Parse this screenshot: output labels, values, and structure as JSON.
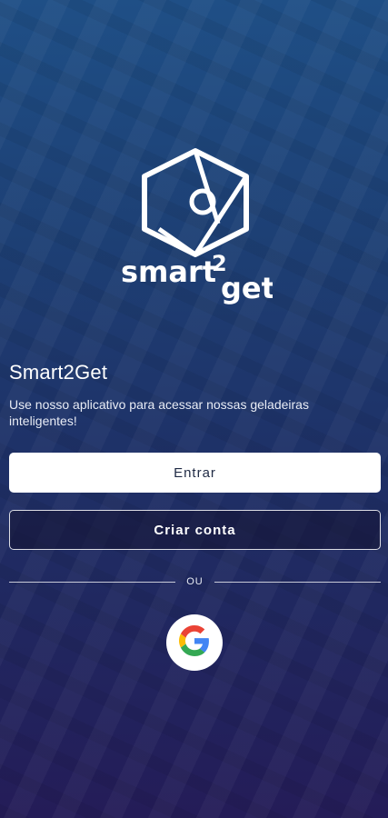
{
  "brand": {
    "logo_text": "smart2get"
  },
  "intro": {
    "title": "Smart2Get",
    "subtitle": "Use nosso aplicativo para acessar nossas geladeiras inteligentes!"
  },
  "actions": {
    "login_label": "Entrar",
    "signup_label": "Criar conta",
    "divider_label": "OU",
    "google_icon": "google-icon"
  },
  "colors": {
    "background_top": "#1f4f86",
    "background_bottom": "#241c58",
    "primary_button": "#ffffff"
  }
}
